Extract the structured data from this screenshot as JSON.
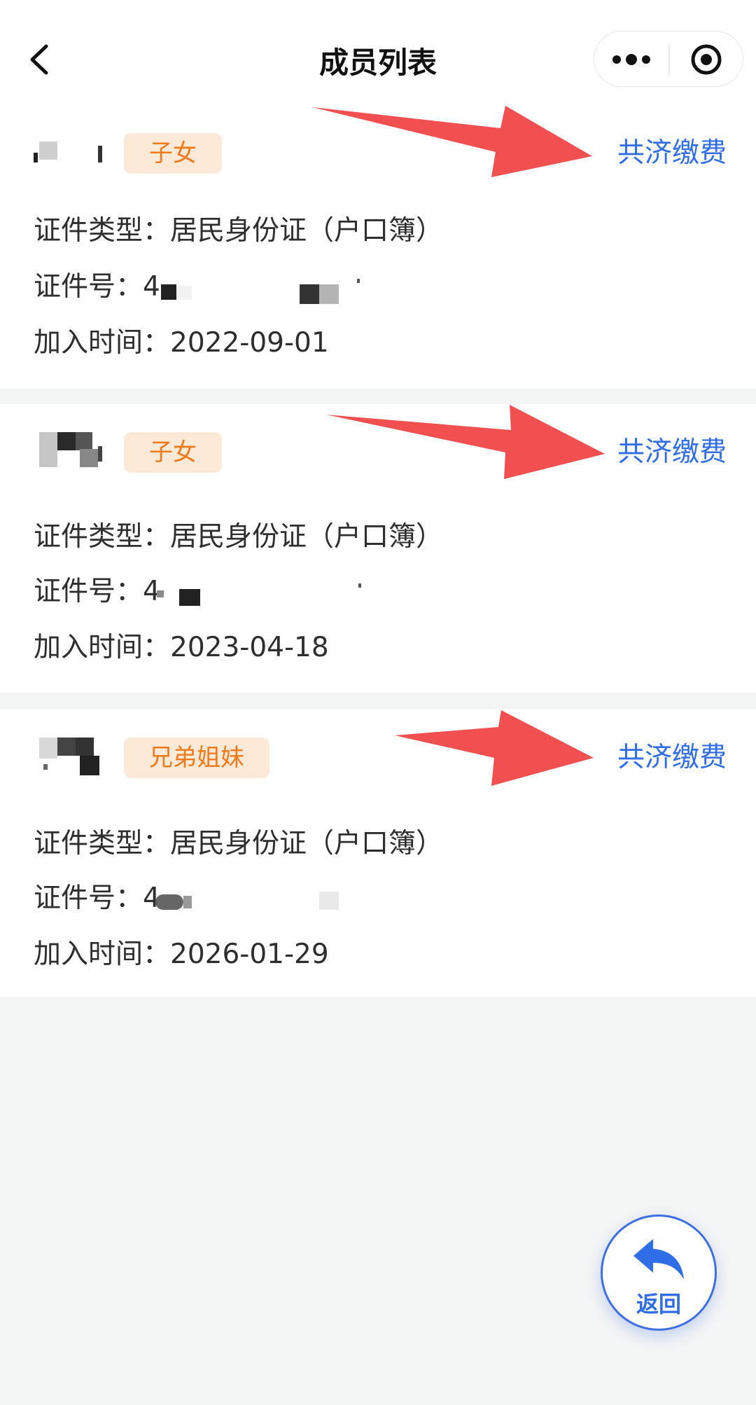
{
  "header": {
    "title": "成员列表",
    "back_icon": "chevron-left-icon",
    "more_icon": "more-dots-icon",
    "close_icon": "target-close-icon"
  },
  "members": [
    {
      "relation": "子女",
      "action": "共济缴费",
      "doc_type_label": "证件类型：",
      "doc_type_value": "居民身份证（户口簿）",
      "id_label": "证件号：",
      "id_prefix": "4",
      "join_label": "加入时间：",
      "join_date": "2022-09-01"
    },
    {
      "relation": "子女",
      "action": "共济缴费",
      "doc_type_label": "证件类型：",
      "doc_type_value": "居民身份证（户口簿）",
      "id_label": "证件号：",
      "id_prefix": "4",
      "join_label": "加入时间：",
      "join_date": "2023-04-18"
    },
    {
      "relation": "兄弟姐妹",
      "action": "共济缴费",
      "doc_type_label": "证件类型：",
      "doc_type_value": "居民身份证（户口簿）",
      "id_label": "证件号：",
      "id_prefix": "4",
      "join_label": "加入时间：",
      "join_date": "2026-01-29"
    }
  ],
  "fab": {
    "label": "返回",
    "icon": "reply-arrow-icon"
  },
  "colors": {
    "accent_blue": "#2f6ee6",
    "tag_bg": "#fde9d8",
    "tag_text": "#f07a1a",
    "annotation_red": "#f25050"
  }
}
